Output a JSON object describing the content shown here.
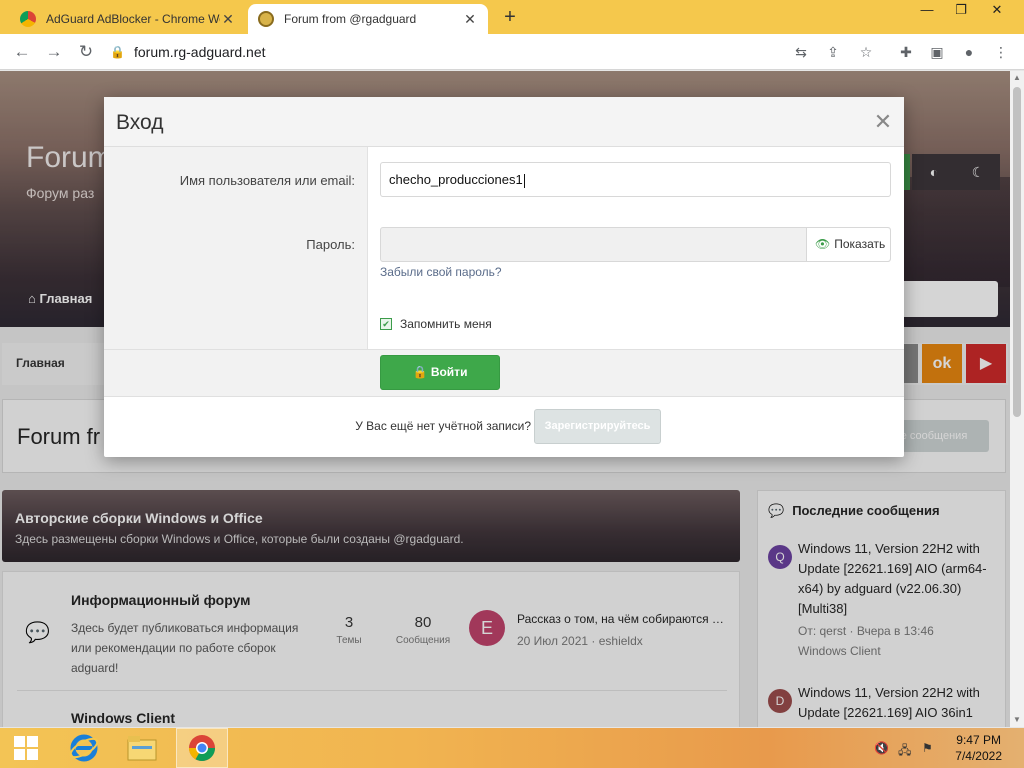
{
  "browser": {
    "tabs": [
      {
        "title": "AdGuard AdBlocker - Chrome Web Store",
        "active": false
      },
      {
        "title": "Forum from @rgadguard",
        "active": true
      }
    ],
    "new_tab_label": "+",
    "url": "forum.rg-adguard.net"
  },
  "page": {
    "hero_title": "Forum",
    "hero_subtitle": "Форум раз",
    "nav_home": "Главная",
    "breadcrumb_home": "Главная",
    "banner_title": "Forum fr",
    "banner_button": "е сообщения",
    "category": {
      "title": "Авторские сборки Windows и Office",
      "description": "Здесь размещены сборки Windows и Office, которые были созданы @rgadguard."
    },
    "forums": [
      {
        "title": "Информационный форум",
        "description_lines": [
          "Здесь будет публиковаться информация",
          "или рекомендации по работе сборок",
          "adguard!"
        ],
        "threads": "3",
        "threads_label": "Темы",
        "messages": "80",
        "messages_label": "Сообщения",
        "avatar_letter": "E",
        "last_title": "Рассказ о том, на чём собираются …",
        "last_meta": "20 Июл 2021 · eshieldx"
      },
      {
        "title": "Windows Client"
      }
    ],
    "sidebar": {
      "title": "Последние сообщения",
      "items": [
        {
          "avatar_letter": "Q",
          "avatar_color": "#6a3fa0",
          "title_lines": [
            "Windows 11, Version 22H2 with",
            "Update [22621.169] AIO (arm64-",
            "x64) by adguard (v22.06.30)",
            "[Multi38]"
          ],
          "meta_1": "От: qerst · Вчера в 13:46",
          "meta_2": "Windows Client"
        },
        {
          "avatar_letter": "D",
          "avatar_color": "#9a4a4a",
          "title_lines": [
            "Windows 11, Version 22H2 with",
            "Update [22621.169] AIO 36in1"
          ]
        }
      ]
    }
  },
  "modal": {
    "title": "Вход",
    "username_label": "Имя пользователя или email:",
    "username_value": "checho_producciones1",
    "password_label": "Пароль:",
    "password_value": "",
    "show_label": "Показать",
    "forgot_label": "Забыли свой пароль?",
    "remember_label": "Запомнить меня",
    "remember_checked": true,
    "login_label": "Войти",
    "no_account_text": "У Вас ещё нет учётной записи?",
    "register_label": "Зарегистрируйтесь"
  },
  "taskbar": {
    "time": "9:47 PM",
    "date": "7/4/2022"
  },
  "colors": {
    "accent_green": "#3ea84a",
    "browser_frame": "#f5c84c",
    "odnoklassniki": "#e8860c",
    "youtube": "#cf2727"
  }
}
